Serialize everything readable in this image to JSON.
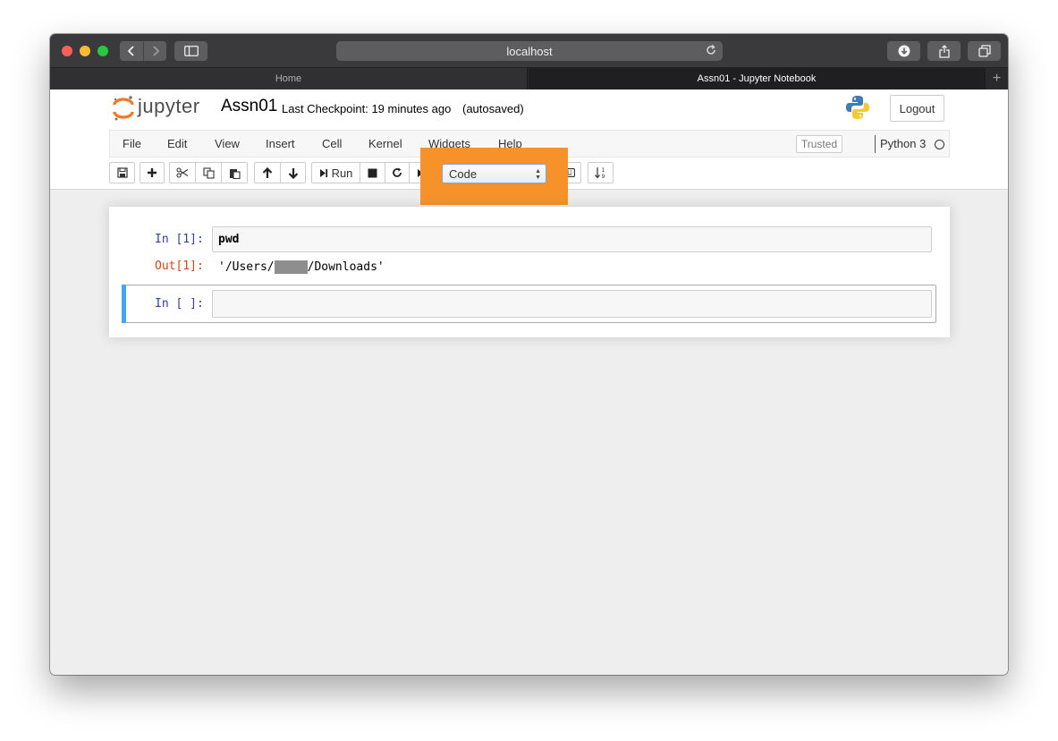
{
  "browser": {
    "url": "localhost",
    "tabs": [
      {
        "label": "Home",
        "active": false
      },
      {
        "label": "Assn01 - Jupyter Notebook",
        "active": true
      }
    ],
    "new_tab": "+"
  },
  "header": {
    "logo_text": "jupyter",
    "notebook_title": "Assn01",
    "checkpoint": "Last Checkpoint: 19 minutes ago",
    "autosave": "(autosaved)",
    "logout_label": "Logout"
  },
  "menu": {
    "items": [
      "File",
      "Edit",
      "View",
      "Insert",
      "Cell",
      "Kernel",
      "Widgets",
      "Help"
    ],
    "trusted_label": "Trusted",
    "kernel_name": "Python 3"
  },
  "toolbar": {
    "run_label": "Run",
    "cell_type": "Code"
  },
  "cells": [
    {
      "in_prompt": "In [1]:",
      "source": "pwd",
      "out_prompt": "Out[1]:",
      "output_prefix": "'/Users/",
      "output_suffix": "/Downloads'"
    },
    {
      "in_prompt": "In [ ]:",
      "source": ""
    }
  ],
  "colors": {
    "highlight": "#f7922a",
    "selected_cell": "#42a5f5",
    "in_prompt": "#303f9f",
    "out_prompt": "#d84315"
  }
}
